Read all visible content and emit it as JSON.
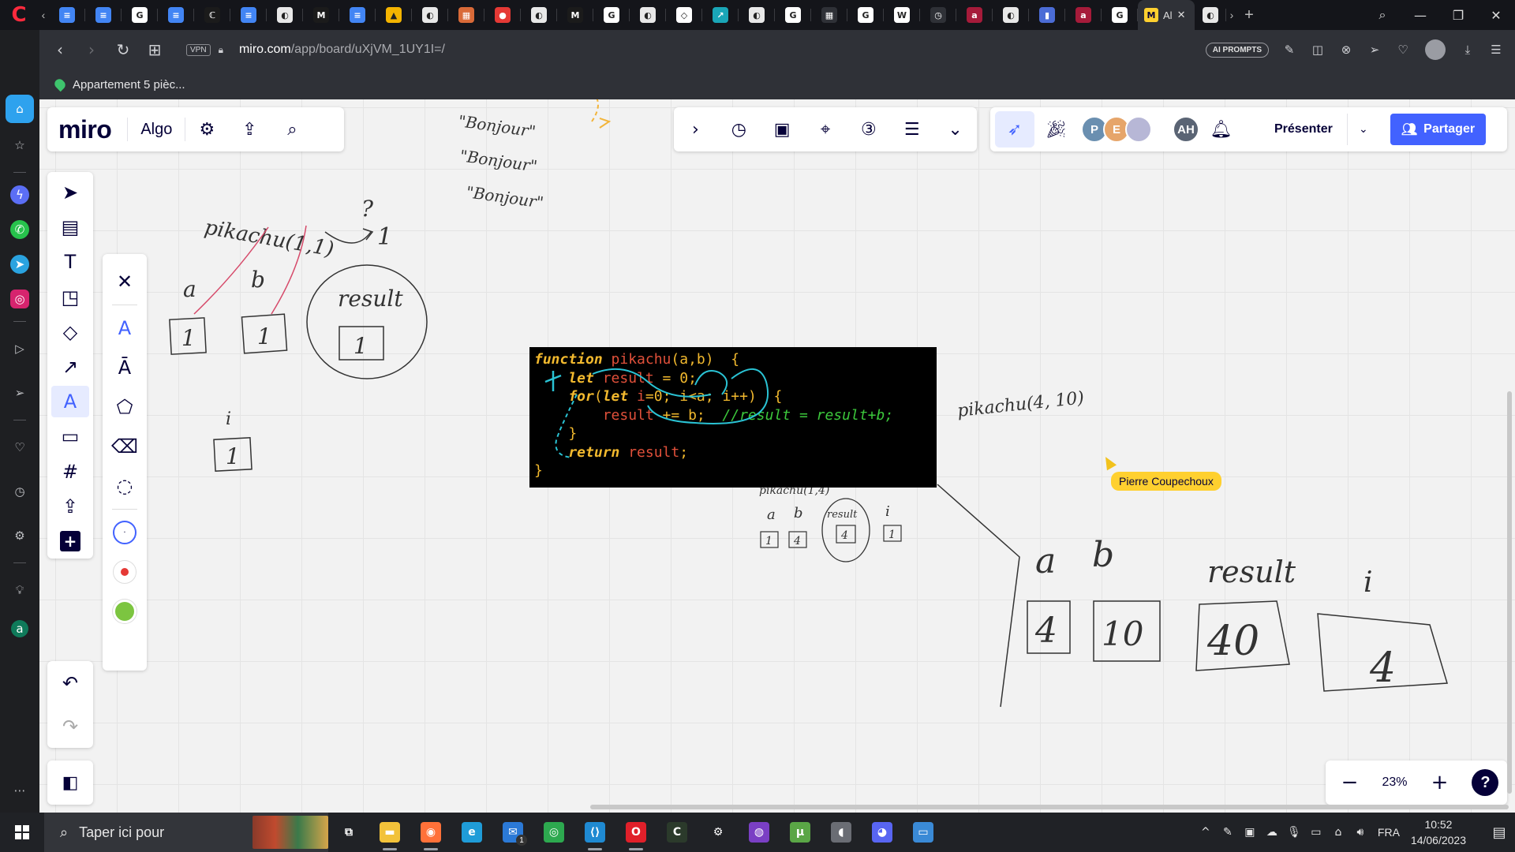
{
  "browser": {
    "tabs": [
      {
        "icon": "docs-icon",
        "color": "#4285f4",
        "glyph": "≡"
      },
      {
        "icon": "docs-icon",
        "color": "#4285f4",
        "glyph": "≡"
      },
      {
        "icon": "google-icon",
        "color": "#ffffff",
        "glyph": "G"
      },
      {
        "icon": "docs-icon",
        "color": "#4285f4",
        "glyph": "≡"
      },
      {
        "icon": "app-icon",
        "color": "#1b1b1b",
        "glyph": "ℂ"
      },
      {
        "icon": "docs-icon",
        "color": "#4285f4",
        "glyph": "≡"
      },
      {
        "icon": "opera-icon",
        "color": "#e8e8e8",
        "glyph": "◐"
      },
      {
        "icon": "miro-icon",
        "color": "#1b1b1b",
        "glyph": "M"
      },
      {
        "icon": "docs-icon",
        "color": "#4285f4",
        "glyph": "≡"
      },
      {
        "icon": "drive-icon",
        "color": "#f4b400",
        "glyph": "▲"
      },
      {
        "icon": "opera-icon",
        "color": "#e8e8e8",
        "glyph": "◐"
      },
      {
        "icon": "image-icon",
        "color": "#d96a38",
        "glyph": "▦"
      },
      {
        "icon": "record-icon",
        "color": "#e53935",
        "glyph": "●"
      },
      {
        "icon": "opera-icon",
        "color": "#e8e8e8",
        "glyph": "◐"
      },
      {
        "icon": "miro-icon",
        "color": "#1b1b1b",
        "glyph": "M"
      },
      {
        "icon": "google-icon",
        "color": "#ffffff",
        "glyph": "G"
      },
      {
        "icon": "opera-icon",
        "color": "#e8e8e8",
        "glyph": "◐"
      },
      {
        "icon": "codepen-icon",
        "color": "#ffffff",
        "glyph": "◇"
      },
      {
        "icon": "app-icon",
        "color": "#1aa6b7",
        "glyph": "↗"
      },
      {
        "icon": "opera-icon",
        "color": "#e8e8e8",
        "glyph": "◐"
      },
      {
        "icon": "google-icon",
        "color": "#ffffff",
        "glyph": "G"
      },
      {
        "icon": "grid-icon",
        "color": "#2f3137",
        "glyph": "▦"
      },
      {
        "icon": "google-icon",
        "color": "#ffffff",
        "glyph": "G"
      },
      {
        "icon": "wikipedia-icon",
        "color": "#ffffff",
        "glyph": "W"
      },
      {
        "icon": "clock-icon",
        "color": "#2f3137",
        "glyph": "◷"
      },
      {
        "icon": "app-icon",
        "color": "#a61b3a",
        "glyph": "a"
      },
      {
        "icon": "opera-icon",
        "color": "#e8e8e8",
        "glyph": "◐"
      },
      {
        "icon": "app-icon",
        "color": "#4b6cd6",
        "glyph": "▮"
      },
      {
        "icon": "app-icon",
        "color": "#a61b3a",
        "glyph": "a"
      },
      {
        "icon": "google-icon",
        "color": "#ffffff",
        "glyph": "G"
      }
    ],
    "active_tab_label": "Al",
    "url_host": "miro.com",
    "url_path": "/app/board/uXjVM_1UY1I=/",
    "vpn_label": "VPN",
    "ai_prompts_label": "AI PROMPTS",
    "bookmark_label": "Appartement 5 pièc..."
  },
  "miro": {
    "logo": "miro",
    "board_name": "Algo",
    "present_label": "Présenter",
    "share_label": "Partager",
    "zoom": "23%",
    "avatars": [
      {
        "initials": "P",
        "color": "#6a8fb0"
      },
      {
        "initials": "E",
        "color": "#e6a56a"
      },
      {
        "initials": "",
        "color": "#b7b7d6"
      }
    ],
    "own_avatar": "AH",
    "own_avatar_color": "#5a6474",
    "cursor_user": "Pierre Coupechoux"
  },
  "code": [
    [
      {
        "c": "kw",
        "t": "function"
      },
      {
        "c": "fn",
        "t": " pikachu"
      },
      {
        "c": "tx",
        "t": "(a,b)  {"
      }
    ],
    [
      {
        "c": "kw",
        "t": "    let"
      },
      {
        "c": "fn",
        "t": " result"
      },
      {
        "c": "tx",
        "t": " = 0;"
      }
    ],
    [
      {
        "c": "kw",
        "t": "    for"
      },
      {
        "c": "tx",
        "t": "("
      },
      {
        "c": "kw",
        "t": "let"
      },
      {
        "c": "fn",
        "t": " i"
      },
      {
        "c": "tx",
        "t": "=0; i<a; i++)  {"
      }
    ],
    [
      {
        "c": "fn",
        "t": "        result"
      },
      {
        "c": "tx",
        "t": " += b;  "
      },
      {
        "c": "cm",
        "t": "//result = result+b;"
      }
    ],
    [
      {
        "c": "tx",
        "t": "    }"
      }
    ],
    [
      {
        "c": "kw",
        "t": "    return"
      },
      {
        "c": "fn",
        "t": " result"
      },
      {
        "c": "tx",
        "t": ";"
      }
    ],
    [
      {
        "c": "tx",
        "t": "}"
      }
    ]
  ],
  "handwriting": {
    "bonjour": [
      "\"Bonjour\"",
      "\"Bonjour\"",
      "\"Bonjour\""
    ],
    "call_1": "pikachu(1,1)",
    "question": "?",
    "result_arrow": "1",
    "var_a": "a",
    "var_b": "b",
    "var_result": "result",
    "box_a": "1",
    "box_b": "1",
    "box_result": "1",
    "var_i": "i",
    "box_i": "1",
    "call_2": "pikachu(4, 10)",
    "call_3": "pikachu(1,4)",
    "small_a": "a",
    "small_b": "b",
    "small_result": "result",
    "small_i": "i",
    "small_box_a": "1",
    "small_box_b": "4",
    "small_box_result": "4",
    "small_box_i": "1",
    "big_a": "a",
    "big_b": "b",
    "big_result": "result",
    "big_i": "i",
    "big_box_a": "4",
    "big_box_b": "10",
    "big_box_result": "40",
    "big_box_i": "4"
  },
  "taskbar": {
    "search_placeholder": "Taper ici pour",
    "apps": [
      {
        "icon": "task-view-icon",
        "color": "#202226",
        "glyph": "⧉",
        "running": false
      },
      {
        "icon": "file-explorer-icon",
        "color": "#f2c23a",
        "glyph": "▬",
        "running": true
      },
      {
        "icon": "firefox-icon",
        "color": "#ff7139",
        "glyph": "◉",
        "running": true
      },
      {
        "icon": "edge-icon",
        "color": "#1f9cd8",
        "glyph": "e",
        "running": false
      },
      {
        "icon": "mail-icon",
        "color": "#2b79d6",
        "glyph": "✉",
        "running": false
      },
      {
        "icon": "chrome-icon",
        "color": "#2da94f",
        "glyph": "◎",
        "running": false
      },
      {
        "icon": "vscode-icon",
        "color": "#1f8ad2",
        "glyph": "⟨⟩",
        "running": true
      },
      {
        "icon": "opera-icon",
        "color": "#e0202a",
        "glyph": "O",
        "running": true
      },
      {
        "icon": "app-icon",
        "color": "#2b3a2b",
        "glyph": "C",
        "running": false
      },
      {
        "icon": "settings-icon",
        "color": "#202226",
        "glyph": "⚙",
        "running": false
      },
      {
        "icon": "app-icon",
        "color": "#7a3fc4",
        "glyph": "◍",
        "running": false
      },
      {
        "icon": "utorrent-icon",
        "color": "#5aa646",
        "glyph": "μ",
        "running": false
      },
      {
        "icon": "app-icon",
        "color": "#6a6d74",
        "glyph": "◖",
        "running": false
      },
      {
        "icon": "discord-icon",
        "color": "#5865f2",
        "glyph": "◕",
        "running": false
      },
      {
        "icon": "app-icon",
        "color": "#3a8ad6",
        "glyph": "▭",
        "running": false
      }
    ],
    "mail_badge": "1",
    "language": "FRA",
    "time": "10:52",
    "date": "14/06/2023"
  }
}
